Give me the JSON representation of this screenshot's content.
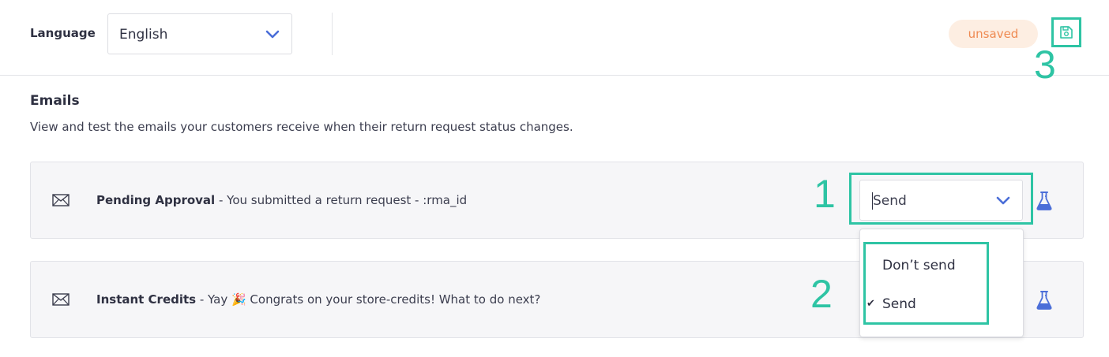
{
  "language": {
    "label": "Language",
    "selected": "English"
  },
  "status": {
    "badge": "unsaved"
  },
  "annotations": [
    "1",
    "2",
    "3"
  ],
  "emails": {
    "title": "Emails",
    "description": "View and test the emails your customers receive when their return request status changes.",
    "rows": [
      {
        "title": "Pending Approval",
        "subject": " - You submitted a return request - :rma_id",
        "send_value": "Send"
      },
      {
        "title": "Instant Credits",
        "subject": " - Yay 🎉 Congrats on your store-credits! What to do next?"
      }
    ]
  },
  "send_dropdown": {
    "options": [
      "Don’t send",
      "Send"
    ],
    "selected": "Send",
    "checkmark": "✔"
  },
  "icons": {
    "mail": "mail-icon",
    "flask": "flask-icon",
    "save": "save-icon",
    "chevron": "chevron-down-icon"
  },
  "colors": {
    "annotation": "#2ec4a4",
    "accent": "#4b6ed8",
    "badge_bg": "#fdeee2",
    "badge_text": "#ef8a52"
  }
}
